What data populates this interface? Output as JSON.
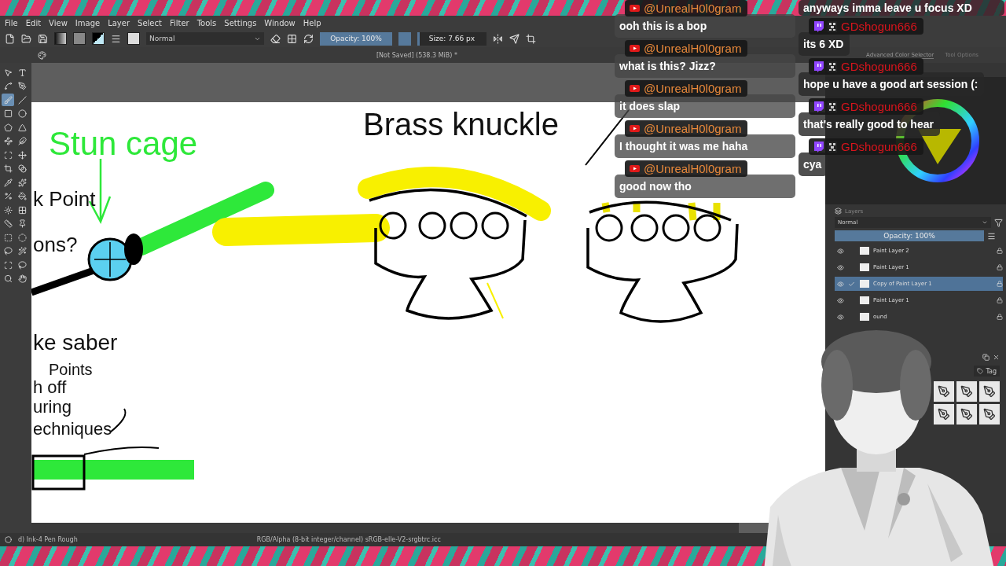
{
  "menu": [
    "File",
    "Edit",
    "View",
    "Image",
    "Layer",
    "Select",
    "Filter",
    "Tools",
    "Settings",
    "Window",
    "Help"
  ],
  "toolbar": {
    "blend_mode": "Normal",
    "opacity": {
      "label": "Opacity: 100%",
      "level": 1
    },
    "size": {
      "label": "Size: 7.66 px",
      "level": 0.03
    }
  },
  "document_title": "[Not Saved]  (538.3 MiB) *",
  "toolbox": [
    {
      "selected": false
    },
    {
      "selected": false
    },
    {
      "selected": false
    },
    {
      "selected": false
    },
    {
      "selected": true
    },
    {
      "selected": false
    },
    {
      "selected": false
    },
    {
      "selected": false
    },
    {
      "selected": false
    },
    {
      "selected": false
    },
    {
      "selected": false
    },
    {
      "selected": false
    },
    {
      "selected": false
    },
    {
      "selected": false
    },
    {
      "selected": false
    },
    {
      "selected": false
    },
    {
      "selected": false
    },
    {
      "selected": false
    },
    {
      "selected": false
    },
    {
      "selected": false
    },
    {
      "selected": false
    },
    {
      "selected": false
    },
    {
      "selected": false
    },
    {
      "selected": false
    },
    {
      "selected": false
    },
    {
      "selected": false
    },
    {
      "selected": false
    },
    {
      "selected": false
    },
    {
      "selected": false
    },
    {
      "selected": false
    },
    {
      "selected": false
    },
    {
      "selected": false
    }
  ],
  "dockers": {
    "tabs": [
      {
        "label": "Advanced Color Selector",
        "selected": true
      },
      {
        "label": "Tool Options",
        "selected": false
      }
    ]
  },
  "canvas_labels": [
    {
      "text": "Stun cage",
      "color": "#2ee83a"
    },
    {
      "text": "Brass knuckle",
      "color": "#111111"
    },
    {
      "text": "k Point",
      "color": "#111111"
    },
    {
      "text": "ons?",
      "color": "#111111"
    },
    {
      "text": "ke saber",
      "color": "#111111"
    },
    {
      "text": "Points",
      "color": "#111111"
    },
    {
      "text": "h off",
      "color": "#111111"
    },
    {
      "text": "uring",
      "color": "#111111"
    },
    {
      "text": "echniques",
      "color": "#111111"
    }
  ],
  "layers": {
    "title": "Layers",
    "blend_mode": "Normal",
    "opacity": {
      "label": "Opacity:  100%",
      "level": 1
    },
    "items": [
      {
        "name": "Paint Layer 2",
        "selected": false
      },
      {
        "name": "Paint Layer 1",
        "selected": false
      },
      {
        "name": "Copy of Paint Layer 1",
        "selected": true
      },
      {
        "name": "Paint Layer 1",
        "selected": false
      },
      {
        "name": "ound",
        "selected": false
      }
    ]
  },
  "brush_presets": {
    "tag": "Tag"
  },
  "status_bar": {
    "brush": "d) Ink-4 Pen Rough",
    "color_space": "RGB/Alpha (8-bit integer/channel)  sRGB-elle-V2-srgbtrc.icc"
  },
  "chat": {
    "left": [
      {
        "kind": "youtube",
        "author": "@UnrealH0l0gram",
        "message": "ooh this is a bop"
      },
      {
        "kind": "youtube",
        "author": "@UnrealH0l0gram",
        "message": "what is this? Jizz?"
      },
      {
        "kind": "youtube",
        "author": "@UnrealH0l0gram",
        "message": "it does slap"
      },
      {
        "kind": "youtube",
        "author": "@UnrealH0l0gram",
        "message": "I thought it was me haha"
      },
      {
        "kind": "youtube",
        "author": "@UnrealH0l0gram",
        "message": "good now tho"
      }
    ],
    "right_top_message": "anyways imma leave u focus XD",
    "right": [
      {
        "kind": "twitch",
        "author": "GDshogun666",
        "message": "its 6 XD"
      },
      {
        "kind": "twitch",
        "author": "GDshogun666",
        "message": "hope u have a good art session (:"
      },
      {
        "kind": "twitch",
        "author": "GDshogun666",
        "message": "that's really good to hear"
      },
      {
        "kind": "twitch",
        "author": "GDshogun666",
        "message": "cya"
      }
    ]
  }
}
